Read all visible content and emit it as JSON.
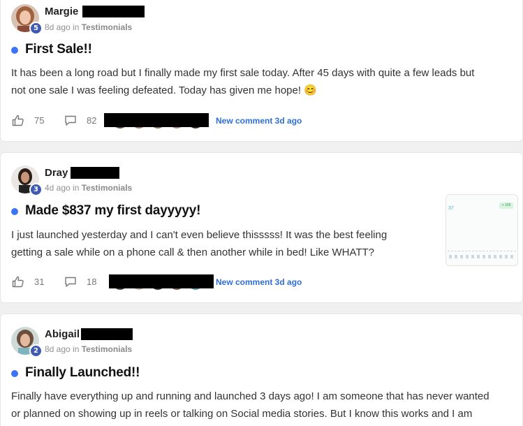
{
  "posts": [
    {
      "author": "Margie",
      "level": "5",
      "time": "8d ago",
      "in_word": "in",
      "category": "Testimonials",
      "title": "First Sale!!",
      "body_lines": [
        "It has been a long road but I finally made my first sale today. After 45 days with quite a few leads but",
        "not one sale I was feeling defeated. Today has given me hope! 😊"
      ],
      "likes": "75",
      "comments": "82",
      "new_comment": "New comment 3d ago"
    },
    {
      "author": "Dray",
      "level": "3",
      "time": "4d ago",
      "in_word": "in",
      "category": "Testimonials",
      "title": "Made $837 my first dayyyyy!",
      "body_lines": [
        "I just launched yesterday and I can't even believe thisssss! It was the best feeling",
        "getting a sale while on a phone call & then another while in bed! Like WHATT?"
      ],
      "likes": "31",
      "comments": "18",
      "new_comment": "New comment 3d ago",
      "thumbnail": {
        "value": "37",
        "badge": "+ 109"
      }
    },
    {
      "author": "Abigail",
      "level": "2",
      "time": "8d ago",
      "in_word": "in",
      "category": "Testimonials",
      "title": "Finally Launched!!",
      "body_lines": [
        "Finally have everything up and running and launched 3 days ago! I am someone that has never wanted",
        "or planned on showing up in reels or talking on Social media stories. But I know this works and I am"
      ]
    }
  ],
  "icons": {
    "like": "thumbs-up-icon",
    "comment": "comment-bubble-icon"
  },
  "colors": {
    "accent_dot": "#3d73f5",
    "link": "#2e6fd8",
    "badge": "#3e5ab1"
  }
}
